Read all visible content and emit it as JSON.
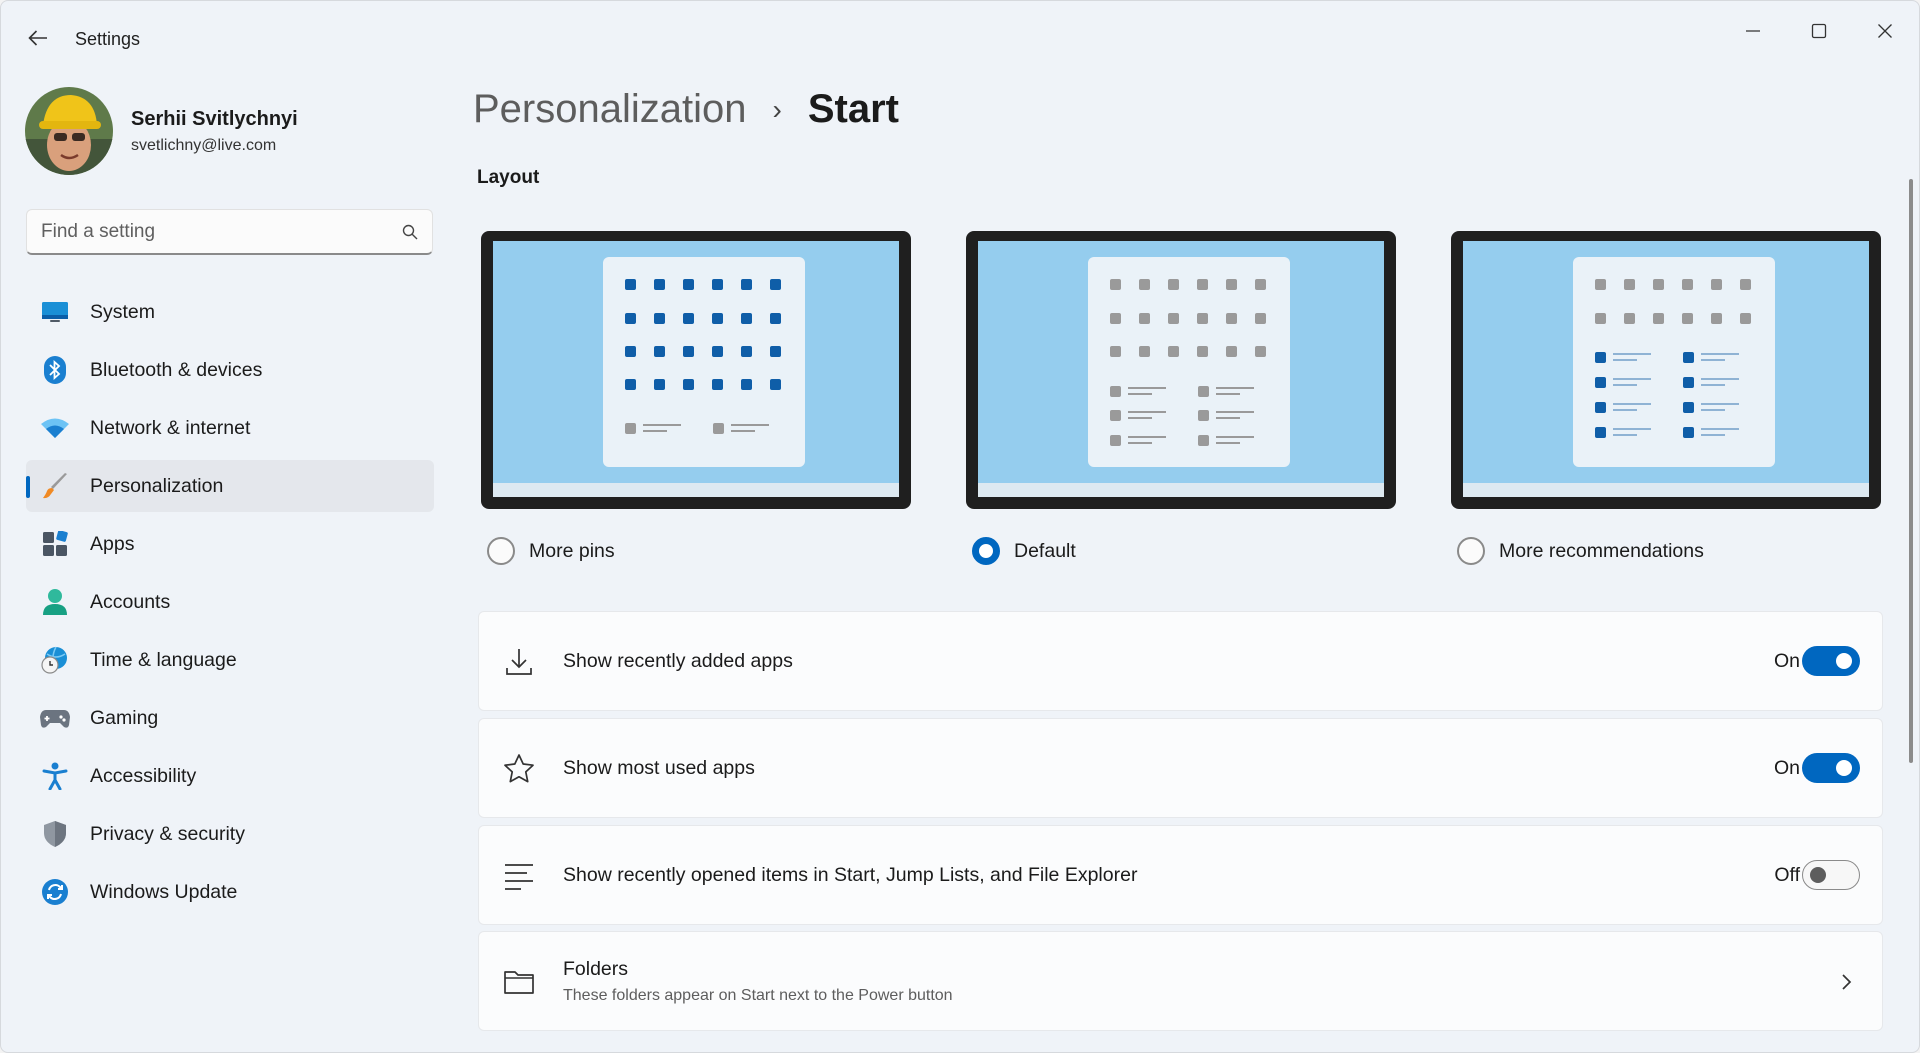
{
  "window": {
    "title": "Settings"
  },
  "user": {
    "name": "Serhii Svitlychnyi",
    "email": "svetlichny@live.com"
  },
  "search": {
    "placeholder": "Find a setting"
  },
  "nav": [
    {
      "label": "System",
      "icon": "system-icon"
    },
    {
      "label": "Bluetooth & devices",
      "icon": "bluetooth-icon"
    },
    {
      "label": "Network & internet",
      "icon": "wifi-icon"
    },
    {
      "label": "Personalization",
      "icon": "paintbrush-icon",
      "selected": true
    },
    {
      "label": "Apps",
      "icon": "apps-icon"
    },
    {
      "label": "Accounts",
      "icon": "accounts-icon"
    },
    {
      "label": "Time & language",
      "icon": "time-language-icon"
    },
    {
      "label": "Gaming",
      "icon": "gamepad-icon"
    },
    {
      "label": "Accessibility",
      "icon": "accessibility-icon"
    },
    {
      "label": "Privacy & security",
      "icon": "shield-icon"
    },
    {
      "label": "Windows Update",
      "icon": "windows-update-icon"
    }
  ],
  "breadcrumb": {
    "parent": "Personalization",
    "separator": "›",
    "current": "Start"
  },
  "layout_section": {
    "label": "Layout",
    "options": [
      {
        "label": "More pins",
        "selected": false
      },
      {
        "label": "Default",
        "selected": true
      },
      {
        "label": "More recommendations",
        "selected": false
      }
    ]
  },
  "settings": [
    {
      "title": "Show recently added apps",
      "state": "On",
      "on": true,
      "icon": "download-icon"
    },
    {
      "title": "Show most used apps",
      "state": "On",
      "on": true,
      "icon": "star-icon"
    },
    {
      "title": "Show recently opened items in Start, Jump Lists, and File Explorer",
      "state": "Off",
      "on": false,
      "icon": "list-icon"
    }
  ],
  "folders": {
    "title": "Folders",
    "subtitle": "These folders appear on Start next to the Power button",
    "icon": "folder-icon"
  },
  "colors": {
    "accent": "#0067c0",
    "window_bg": "#eff3f8",
    "card_bg": "#fbfcfd",
    "preview_screen": "#95cdee",
    "pin_blue": "#0f5ea8",
    "pin_grey": "#9a9a9a"
  }
}
